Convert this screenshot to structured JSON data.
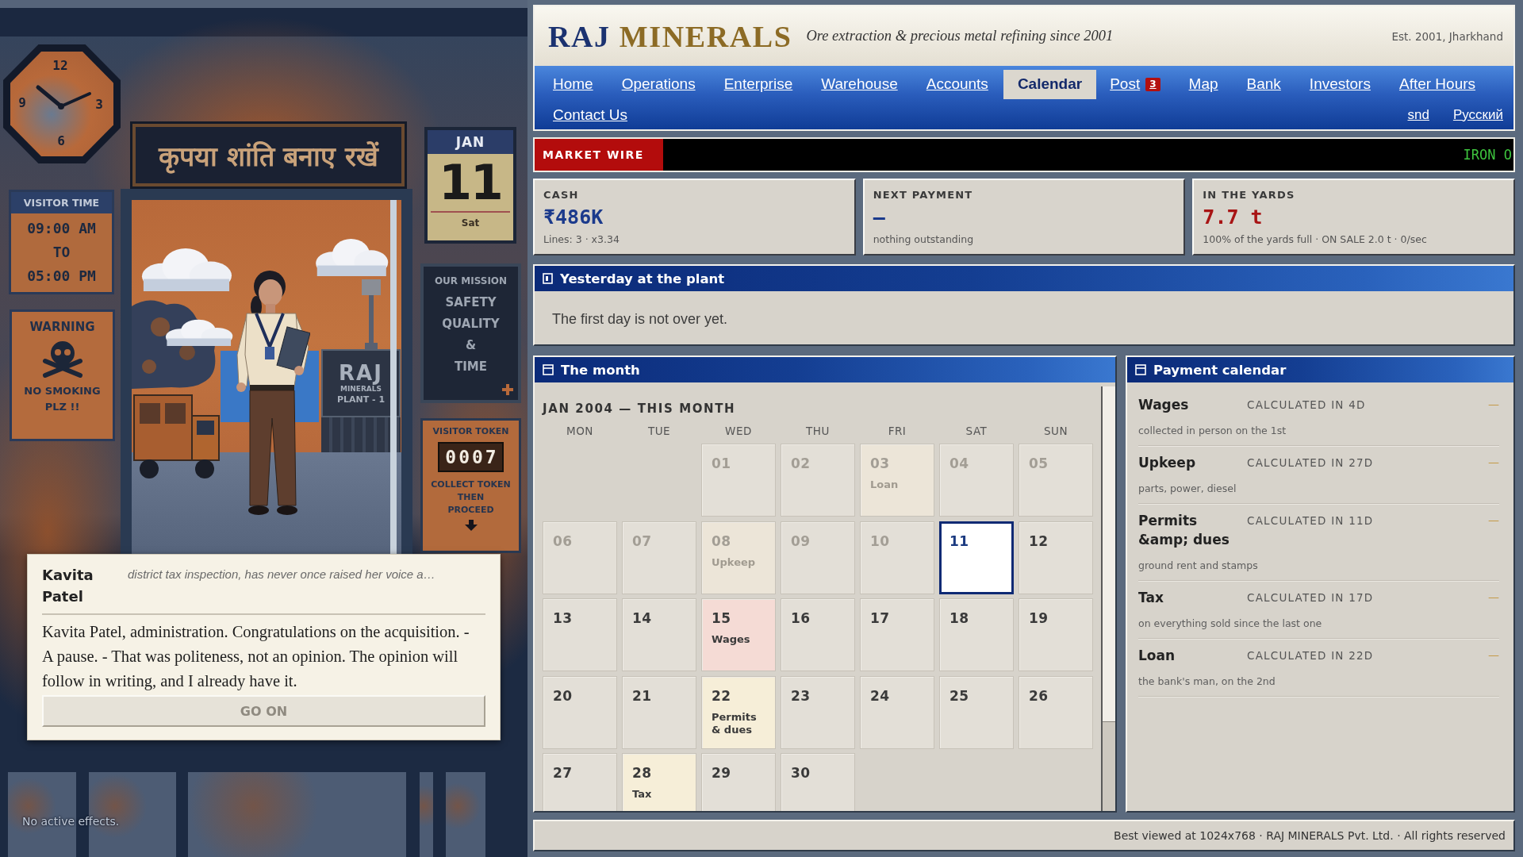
{
  "scene": {
    "clock": {
      "numerals": [
        "12",
        "3",
        "6",
        "9"
      ]
    },
    "banner": "कृपया शांति बनाए रखें",
    "wall_calendar": {
      "month": "JAN",
      "day": "11",
      "weekday": "Sat"
    },
    "visitor_time": {
      "title": "VISITOR TIME",
      "lines": [
        "09:00 AM",
        "TO",
        "05:00 PM"
      ]
    },
    "warning": {
      "title": "WARNING",
      "lines": [
        "NO SMOKING",
        "PLZ !!"
      ]
    },
    "mission": {
      "title": "OUR MISSION",
      "lines": [
        "SAFETY",
        "QUALITY",
        "&",
        "TIME"
      ]
    },
    "token": {
      "title": "VISITOR TOKEN",
      "counter": "0007",
      "lines": [
        "COLLECT TOKEN",
        "THEN",
        "PROCEED"
      ]
    },
    "plant_sign": {
      "lines": [
        "RAJ",
        "MINERALS",
        "PLANT - 1"
      ]
    },
    "effects": "No active effects."
  },
  "dialog": {
    "speaker": "Kavita Patel",
    "description": "district tax inspection, has never once raised her voice a…",
    "text": "Kavita Patel, administration. Congratulations on the acquisition. - A pause. - That was politeness, not an opinion. The opinion will follow in writing, and I already have it.",
    "button": {
      "label": "GO ON",
      "disabled": true
    }
  },
  "header": {
    "brand": [
      "RAJ",
      "MINERALS"
    ],
    "tagline": "Ore extraction & precious metal refining since 2001",
    "established": "Est. 2001, Jharkhand"
  },
  "nav": {
    "links": [
      {
        "label": "Home",
        "selected": false
      },
      {
        "label": "Operations",
        "selected": false
      },
      {
        "label": "Enterprise",
        "selected": false
      },
      {
        "label": "Warehouse",
        "selected": false
      },
      {
        "label": "Accounts",
        "selected": false
      },
      {
        "label": "Calendar",
        "selected": true
      },
      {
        "label": "Post",
        "selected": false,
        "badge": "3"
      },
      {
        "label": "Map",
        "selected": false
      },
      {
        "label": "Bank",
        "selected": false
      },
      {
        "label": "Investors",
        "selected": false
      },
      {
        "label": "After Hours",
        "selected": false
      }
    ],
    "more_links": [
      {
        "label": "Contact Us",
        "selected": false
      }
    ],
    "languages": [
      "snd",
      "Русский"
    ]
  },
  "market_wire": {
    "label": "MARKET WIRE",
    "ticker": "IRON O"
  },
  "stats": [
    {
      "label": "CASH",
      "value": "₹486K",
      "color": "#1b3a8c",
      "note": "Lines: 3 · x3.34"
    },
    {
      "label": "NEXT PAYMENT",
      "value": "—",
      "color": "#1b3a8c",
      "note": "nothing outstanding"
    },
    {
      "label": "IN THE YARDS",
      "value": "7.7 t",
      "color": "#a81414",
      "note": "100% of the yards full · ON SALE 2.0 t · 0/sec"
    }
  ],
  "yesterday": {
    "title": "Yesterday at the plant",
    "text": "The first day is not over yet."
  },
  "month": {
    "title": "The month",
    "heading": "JAN 2004 — THIS MONTH",
    "weekdays": [
      "MON",
      "TUE",
      "WED",
      "THU",
      "FRI",
      "SAT",
      "SUN"
    ],
    "weeks": [
      [
        {
          "kind": "blank"
        },
        {
          "kind": "blank"
        },
        {
          "kind": "day",
          "day": "01",
          "past": true,
          "selected": false
        },
        {
          "kind": "day",
          "day": "02",
          "past": true,
          "selected": false
        },
        {
          "kind": "day",
          "day": "03",
          "past": true,
          "selected": false,
          "event": "Loan",
          "color": "#ece5d8"
        },
        {
          "kind": "day",
          "day": "04",
          "past": true,
          "selected": false
        },
        {
          "kind": "day",
          "day": "05",
          "past": true,
          "selected": false
        }
      ],
      [
        {
          "kind": "day",
          "day": "06",
          "past": true,
          "selected": false
        },
        {
          "kind": "day",
          "day": "07",
          "past": true,
          "selected": false
        },
        {
          "kind": "day",
          "day": "08",
          "past": true,
          "selected": false,
          "event": "Upkeep",
          "color": "#ece5d8"
        },
        {
          "kind": "day",
          "day": "09",
          "past": true,
          "selected": false
        },
        {
          "kind": "day",
          "day": "10",
          "past": true,
          "selected": false
        },
        {
          "kind": "day",
          "day": "11",
          "past": false,
          "selected": true
        },
        {
          "kind": "day",
          "day": "12",
          "past": false,
          "selected": false
        }
      ],
      [
        {
          "kind": "day",
          "day": "13",
          "past": false,
          "selected": false
        },
        {
          "kind": "day",
          "day": "14",
          "past": false,
          "selected": false
        },
        {
          "kind": "day",
          "day": "15",
          "past": false,
          "selected": false,
          "event": "Wages",
          "color": "#f5dbd5"
        },
        {
          "kind": "day",
          "day": "16",
          "past": false,
          "selected": false
        },
        {
          "kind": "day",
          "day": "17",
          "past": false,
          "selected": false
        },
        {
          "kind": "day",
          "day": "18",
          "past": false,
          "selected": false
        },
        {
          "kind": "day",
          "day": "19",
          "past": false,
          "selected": false
        }
      ],
      [
        {
          "kind": "day",
          "day": "20",
          "past": false,
          "selected": false
        },
        {
          "kind": "day",
          "day": "21",
          "past": false,
          "selected": false
        },
        {
          "kind": "day",
          "day": "22",
          "past": false,
          "selected": false,
          "event": "Permits & dues",
          "color": "#f6eed8"
        },
        {
          "kind": "day",
          "day": "23",
          "past": false,
          "selected": false
        },
        {
          "kind": "day",
          "day": "24",
          "past": false,
          "selected": false
        },
        {
          "kind": "day",
          "day": "25",
          "past": false,
          "selected": false
        },
        {
          "kind": "day",
          "day": "26",
          "past": false,
          "selected": false
        }
      ],
      [
        {
          "kind": "day",
          "day": "27",
          "past": false,
          "selected": false
        },
        {
          "kind": "day",
          "day": "28",
          "past": false,
          "selected": false,
          "event": "Tax",
          "color": "#f6eed8"
        },
        {
          "kind": "day",
          "day": "29",
          "past": false,
          "selected": false
        },
        {
          "kind": "day",
          "day": "30",
          "past": false,
          "selected": false
        }
      ]
    ]
  },
  "payments": {
    "title": "Payment calendar",
    "items": [
      {
        "name": "Wages",
        "due": "CALCULATED IN 4D",
        "amount": "—",
        "note": "collected in person on the 1st"
      },
      {
        "name": "Upkeep",
        "due": "CALCULATED IN 27D",
        "amount": "—",
        "note": "parts, power, diesel"
      },
      {
        "name": "Permits &amp; dues",
        "due": "CALCULATED IN 11D",
        "amount": "—",
        "note": "ground rent and stamps"
      },
      {
        "name": "Tax",
        "due": "CALCULATED IN 17D",
        "amount": "—",
        "note": "on everything sold since the last one"
      },
      {
        "name": "Loan",
        "due": "CALCULATED IN 22D",
        "amount": "—",
        "note": "the bank's man, on the 2nd"
      }
    ]
  },
  "footer": "Best viewed at 1024x768 · RAJ MINERALS Pvt. Ltd. · All rights reserved"
}
